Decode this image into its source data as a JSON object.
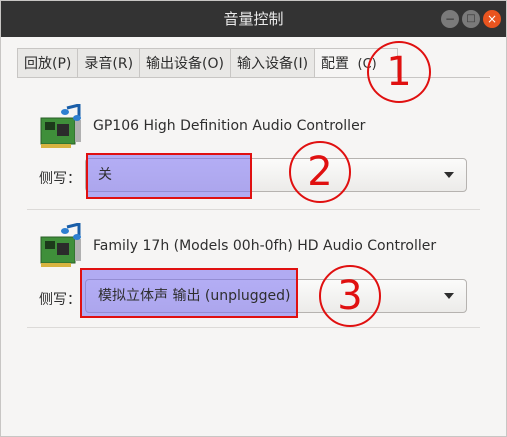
{
  "window": {
    "title": "音量控制",
    "controls": {
      "minimize": "−",
      "maximize": "□",
      "close": "×"
    }
  },
  "tabs": [
    {
      "label": "回放(P)",
      "active": false
    },
    {
      "label": "录音(R)",
      "active": false
    },
    {
      "label": "输出设备(O)",
      "active": false
    },
    {
      "label": "输入设备(I)",
      "active": false
    },
    {
      "label": "配置",
      "active": true
    }
  ],
  "devices": [
    {
      "name": "GP106 High Definition Audio Controller",
      "profile_label": "侧写：",
      "profile_value": "关",
      "icon": "sound-card-icon"
    },
    {
      "name": "Family 17h (Models 00h-0fh) HD Audio Controller",
      "profile_label": "侧写：",
      "profile_value": "模拟立体声 输出 (unplugged)",
      "icon": "sound-card-icon"
    }
  ],
  "annotations": {
    "tab_suffix": "(C)",
    "callouts": [
      "1",
      "2",
      "3"
    ],
    "highlight_color": "#e01010"
  }
}
